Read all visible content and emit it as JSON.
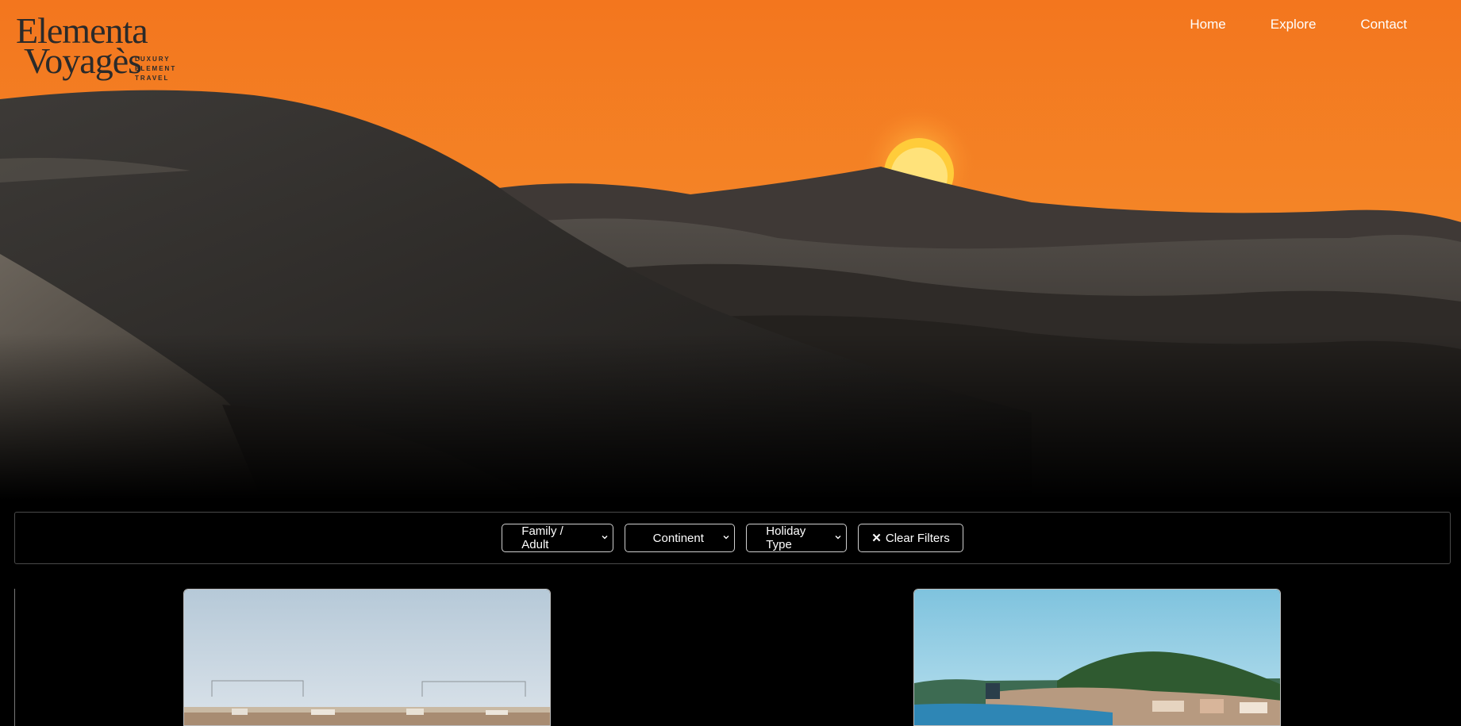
{
  "logo": {
    "line1": "Elementa",
    "line2": "Voyagès",
    "tagline": [
      "LUXURY",
      "ELEMENT",
      "TRAVEL"
    ]
  },
  "nav": {
    "items": [
      "Home",
      "Explore",
      "Contact"
    ]
  },
  "filters": {
    "audience": "Family / Adult",
    "continent": "Continent",
    "holiday_type": "Holiday Type",
    "clear_label": "Clear Filters",
    "clear_icon": "close-icon",
    "dropdown_icon": "chevron-down-icon"
  },
  "hero": {
    "image": "desert-dunes-at-sunset",
    "sky_top": "#f3761e",
    "sky_bottom": "#e86a2a"
  },
  "cards": [
    {
      "image": "city-rooftops-under-pale-sky"
    },
    {
      "image": "coastal-town-with-harbor-and-green-hill"
    }
  ]
}
